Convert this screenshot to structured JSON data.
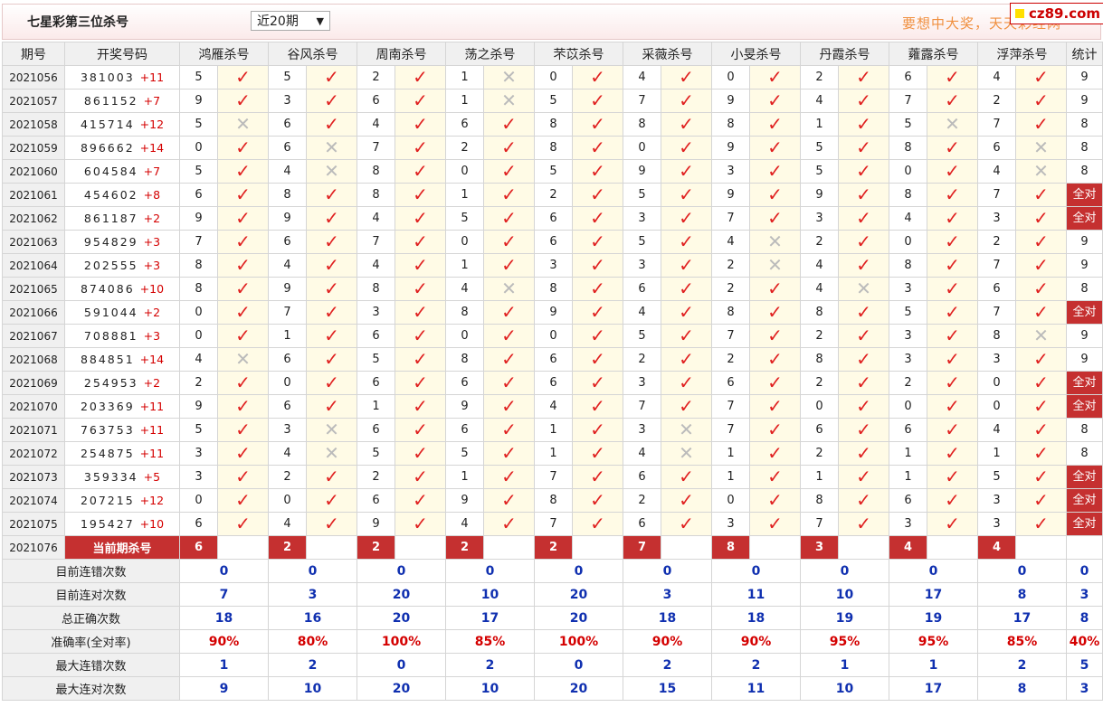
{
  "header": {
    "title": "七星彩第三位杀号",
    "period_select": "近20期",
    "promo": "要想中大奖，天天彩经网",
    "badge": "cz89.com"
  },
  "columns": [
    "期号",
    "开奖号码",
    "鸿雁杀号",
    "谷风杀号",
    "周南杀号",
    "荡之杀号",
    "芣苡杀号",
    "采薇杀号",
    "小旻杀号",
    "丹霞杀号",
    "蕹露杀号",
    "浮萍杀号",
    "统计"
  ],
  "rows": [
    {
      "issue": "2021056",
      "digits": "381003",
      "plus": "+11",
      "kill": [
        5,
        5,
        2,
        1,
        0,
        4,
        0,
        2,
        6,
        4
      ],
      "ok": [
        1,
        1,
        1,
        0,
        1,
        1,
        1,
        1,
        1,
        1
      ],
      "stat": "9"
    },
    {
      "issue": "2021057",
      "digits": "861152",
      "plus": "+7",
      "kill": [
        9,
        3,
        6,
        1,
        5,
        7,
        9,
        4,
        7,
        2
      ],
      "ok": [
        1,
        1,
        1,
        0,
        1,
        1,
        1,
        1,
        1,
        1
      ],
      "stat": "9"
    },
    {
      "issue": "2021058",
      "digits": "415714",
      "plus": "+12",
      "kill": [
        5,
        6,
        4,
        6,
        8,
        8,
        8,
        1,
        5,
        7
      ],
      "ok": [
        0,
        1,
        1,
        1,
        1,
        1,
        1,
        1,
        0,
        1
      ],
      "stat": "8"
    },
    {
      "issue": "2021059",
      "digits": "896662",
      "plus": "+14",
      "kill": [
        0,
        6,
        7,
        2,
        8,
        0,
        9,
        5,
        8,
        6
      ],
      "ok": [
        1,
        0,
        1,
        1,
        1,
        1,
        1,
        1,
        1,
        0
      ],
      "stat": "8"
    },
    {
      "issue": "2021060",
      "digits": "604584",
      "plus": "+7",
      "kill": [
        5,
        4,
        8,
        0,
        5,
        9,
        3,
        5,
        0,
        4
      ],
      "ok": [
        1,
        0,
        1,
        1,
        1,
        1,
        1,
        1,
        1,
        0
      ],
      "stat": "8"
    },
    {
      "issue": "2021061",
      "digits": "454602",
      "plus": "+8",
      "kill": [
        6,
        8,
        8,
        1,
        2,
        5,
        9,
        9,
        8,
        7
      ],
      "ok": [
        1,
        1,
        1,
        1,
        1,
        1,
        1,
        1,
        1,
        1
      ],
      "stat": "全对"
    },
    {
      "issue": "2021062",
      "digits": "861187",
      "plus": "+2",
      "kill": [
        9,
        9,
        4,
        5,
        6,
        3,
        7,
        3,
        4,
        3
      ],
      "ok": [
        1,
        1,
        1,
        1,
        1,
        1,
        1,
        1,
        1,
        1
      ],
      "stat": "全对"
    },
    {
      "issue": "2021063",
      "digits": "954829",
      "plus": "+3",
      "kill": [
        7,
        6,
        7,
        0,
        6,
        5,
        4,
        2,
        0,
        2
      ],
      "ok": [
        1,
        1,
        1,
        1,
        1,
        1,
        0,
        1,
        1,
        1
      ],
      "stat": "9"
    },
    {
      "issue": "2021064",
      "digits": "202555",
      "plus": "+3",
      "kill": [
        8,
        4,
        4,
        1,
        3,
        3,
        2,
        4,
        8,
        7
      ],
      "ok": [
        1,
        1,
        1,
        1,
        1,
        1,
        0,
        1,
        1,
        1
      ],
      "stat": "9"
    },
    {
      "issue": "2021065",
      "digits": "874086",
      "plus": "+10",
      "kill": [
        8,
        9,
        8,
        4,
        8,
        6,
        2,
        4,
        3,
        6
      ],
      "ok": [
        1,
        1,
        1,
        0,
        1,
        1,
        1,
        0,
        1,
        1
      ],
      "stat": "8"
    },
    {
      "issue": "2021066",
      "digits": "591044",
      "plus": "+2",
      "kill": [
        0,
        7,
        3,
        8,
        9,
        4,
        8,
        8,
        5,
        7
      ],
      "ok": [
        1,
        1,
        1,
        1,
        1,
        1,
        1,
        1,
        1,
        1
      ],
      "stat": "全对"
    },
    {
      "issue": "2021067",
      "digits": "708881",
      "plus": "+3",
      "kill": [
        0,
        1,
        6,
        0,
        0,
        5,
        7,
        2,
        3,
        8
      ],
      "ok": [
        1,
        1,
        1,
        1,
        1,
        1,
        1,
        1,
        1,
        0
      ],
      "stat": "9"
    },
    {
      "issue": "2021068",
      "digits": "884851",
      "plus": "+14",
      "kill": [
        4,
        6,
        5,
        8,
        6,
        2,
        2,
        8,
        3,
        3
      ],
      "ok": [
        0,
        1,
        1,
        1,
        1,
        1,
        1,
        1,
        1,
        1
      ],
      "stat": "9"
    },
    {
      "issue": "2021069",
      "digits": "254953",
      "plus": "+2",
      "kill": [
        2,
        0,
        6,
        6,
        6,
        3,
        6,
        2,
        2,
        0
      ],
      "ok": [
        1,
        1,
        1,
        1,
        1,
        1,
        1,
        1,
        1,
        1
      ],
      "stat": "全对"
    },
    {
      "issue": "2021070",
      "digits": "203369",
      "plus": "+11",
      "kill": [
        9,
        6,
        1,
        9,
        4,
        7,
        7,
        0,
        0,
        0
      ],
      "ok": [
        1,
        1,
        1,
        1,
        1,
        1,
        1,
        1,
        1,
        1
      ],
      "stat": "全对"
    },
    {
      "issue": "2021071",
      "digits": "763753",
      "plus": "+11",
      "kill": [
        5,
        3,
        6,
        6,
        1,
        3,
        7,
        6,
        6,
        4
      ],
      "ok": [
        1,
        0,
        1,
        1,
        1,
        0,
        1,
        1,
        1,
        1
      ],
      "stat": "8"
    },
    {
      "issue": "2021072",
      "digits": "254875",
      "plus": "+11",
      "kill": [
        3,
        4,
        5,
        5,
        1,
        4,
        1,
        2,
        1,
        1
      ],
      "ok": [
        1,
        0,
        1,
        1,
        1,
        0,
        1,
        1,
        1,
        1
      ],
      "stat": "8"
    },
    {
      "issue": "2021073",
      "digits": "359334",
      "plus": "+5",
      "kill": [
        3,
        2,
        2,
        1,
        7,
        6,
        1,
        1,
        1,
        5
      ],
      "ok": [
        1,
        1,
        1,
        1,
        1,
        1,
        1,
        1,
        1,
        1
      ],
      "stat": "全对"
    },
    {
      "issue": "2021074",
      "digits": "207215",
      "plus": "+12",
      "kill": [
        0,
        0,
        6,
        9,
        8,
        2,
        0,
        8,
        6,
        3
      ],
      "ok": [
        1,
        1,
        1,
        1,
        1,
        1,
        1,
        1,
        1,
        1
      ],
      "stat": "全对"
    },
    {
      "issue": "2021075",
      "digits": "195427",
      "plus": "+10",
      "kill": [
        6,
        4,
        9,
        4,
        7,
        6,
        3,
        7,
        3,
        3
      ],
      "ok": [
        1,
        1,
        1,
        1,
        1,
        1,
        1,
        1,
        1,
        1
      ],
      "stat": "全对"
    }
  ],
  "current": {
    "issue": "2021076",
    "label": "当前期杀号",
    "kill": [
      6,
      2,
      2,
      2,
      2,
      7,
      8,
      3,
      4,
      4
    ]
  },
  "stats": [
    {
      "label": "目前连错次数",
      "values": [
        "0",
        "0",
        "0",
        "0",
        "0",
        "0",
        "0",
        "0",
        "0",
        "0",
        "0"
      ],
      "red": false
    },
    {
      "label": "目前连对次数",
      "values": [
        "7",
        "3",
        "20",
        "10",
        "20",
        "3",
        "11",
        "10",
        "17",
        "8",
        "3"
      ],
      "red": false
    },
    {
      "label": "总正确次数",
      "values": [
        "18",
        "16",
        "20",
        "17",
        "20",
        "18",
        "18",
        "19",
        "19",
        "17",
        "8"
      ],
      "red": false
    },
    {
      "label": "准确率(全对率)",
      "values": [
        "90%",
        "80%",
        "100%",
        "85%",
        "100%",
        "90%",
        "90%",
        "95%",
        "95%",
        "85%",
        "40%"
      ],
      "red": true
    },
    {
      "label": "最大连错次数",
      "values": [
        "1",
        "2",
        "0",
        "2",
        "0",
        "2",
        "2",
        "1",
        "1",
        "2",
        "5"
      ],
      "red": false
    },
    {
      "label": "最大连对次数",
      "values": [
        "9",
        "10",
        "20",
        "10",
        "20",
        "15",
        "11",
        "10",
        "17",
        "8",
        "3"
      ],
      "red": false
    }
  ],
  "symbols": {
    "ok": "✓",
    "no": "✕"
  }
}
